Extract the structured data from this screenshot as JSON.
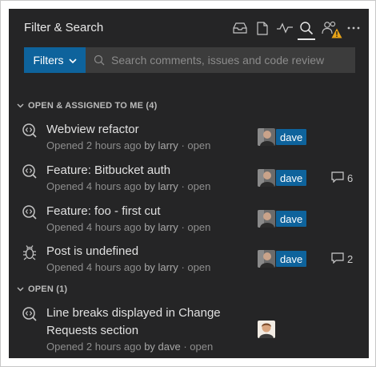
{
  "header": {
    "title": "Filter & Search",
    "icons": [
      "inbox-icon",
      "file-icon",
      "activity-icon",
      "search-icon",
      "people-icon",
      "warning-icon",
      "more-icon"
    ]
  },
  "filters": {
    "label": "Filters",
    "search_placeholder": "Search comments, issues and code review"
  },
  "sections": [
    {
      "title": "OPEN & ASSIGNED TO ME (4)",
      "items": [
        {
          "title": "Webview refactor",
          "meta_prefix": "Opened",
          "time": "2 hours ago",
          "by": "by larry",
          "status": "· open",
          "assignee": "dave",
          "comments": ""
        },
        {
          "title": "Feature: Bitbucket auth",
          "meta_prefix": "Opened",
          "time": "4 hours ago",
          "by": "by larry",
          "status": "· open",
          "assignee": "dave",
          "comments": "6"
        },
        {
          "title": "Feature: foo - first cut",
          "meta_prefix": "Opened",
          "time": "4 hours ago",
          "by": "by larry",
          "status": "· open",
          "assignee": "dave",
          "comments": ""
        },
        {
          "title": "Post is undefined",
          "meta_prefix": "Opened",
          "time": "4 hours ago",
          "by": "by larry",
          "status": "· open",
          "assignee": "dave",
          "comments": "2"
        }
      ]
    },
    {
      "title": "OPEN (1)",
      "items": [
        {
          "title_line1": "Line breaks displayed in Change",
          "title_line2": "Requests section",
          "meta_prefix": "Opened",
          "time": "2 hours ago",
          "by": "by dave",
          "status": "· open"
        }
      ]
    }
  ],
  "colors": {
    "panel_bg": "#252526",
    "accent": "#0e639c",
    "warning": "#e8a317"
  }
}
